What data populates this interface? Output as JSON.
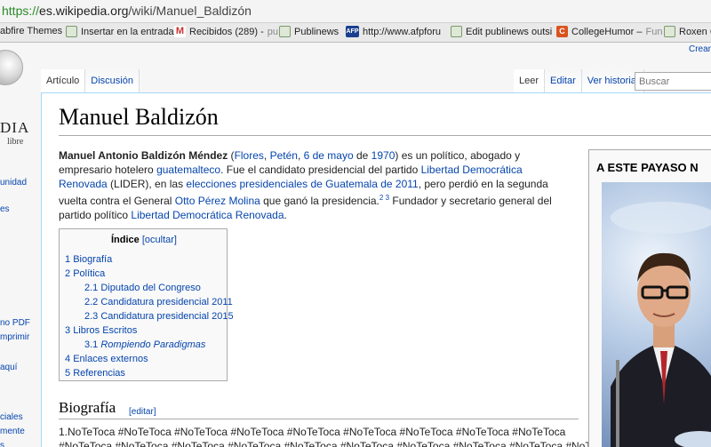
{
  "browser": {
    "url_scheme": "https://",
    "url_host": "es.wikipedia.org",
    "url_path": "/wiki/Manuel_Baldizón",
    "bookmarks": [
      {
        "label": "abfire Themes",
        "icon": "none",
        "ghost": ""
      },
      {
        "label": "Insertar en la entrada",
        "icon": "page-icon",
        "ghost": ""
      },
      {
        "label": "Recibidos (289) -",
        "icon": "gmail-icon",
        "ghost": "pu"
      },
      {
        "label": "Publinews",
        "icon": "page-icon",
        "ghost": ""
      },
      {
        "label": "http://www.afpforu",
        "icon": "afp-icon",
        "ghost": ""
      },
      {
        "label": "Edit publinews outsi",
        "icon": "page-icon",
        "ghost": ""
      },
      {
        "label": "CollegeHumor –",
        "icon": "ch-icon",
        "ghost": "Fun"
      },
      {
        "label": "Roxen C",
        "icon": "page-icon",
        "ghost": ""
      }
    ]
  },
  "wiki": {
    "logo_word": "DIA",
    "logo_sub": "libre",
    "crear": "Crear",
    "sidebar": [
      "unidad",
      "es",
      "no PDF",
      "mprimir",
      "aquí",
      "ciales",
      "mente",
      "s"
    ],
    "tabs_left": [
      "Artículo",
      "Discusión"
    ],
    "tabs_right": [
      "Leer",
      "Editar",
      "Ver historial"
    ],
    "search_placeholder": "Buscar",
    "title": "Manuel Baldizón",
    "lead": {
      "bold_name": "Manuel Antonio Baldizón Méndez",
      "open_paren": " (",
      "link_flores": "Flores",
      "comma1": ", ",
      "link_peten": "Petén",
      "comma2": ", ",
      "link_mayo": "6 de mayo",
      "de": " de ",
      "link_1970": "1970",
      "text1": ") es un político, abogado y empresario hotelero ",
      "link_guatemalteco": "guatemalteco",
      "text2": ". Fue el candidato presidencial del partido ",
      "link_lider": "Libertad Democrática Renovada",
      "text3": " (LIDER), en las ",
      "link_elecciones": "elecciones presidenciales de Guatemala de 2011",
      "text4": ", pero perdió en la segunda vuelta contra el General ",
      "link_otto": "Otto Pérez Molina",
      "text5": " que ganó la presidencia.",
      "sup": "2 3",
      "text6": " Fundador y secretario general del partido político ",
      "link_lider2": "Libertad Democrática Renovada",
      "text7": "."
    },
    "toc": {
      "title": "Índice",
      "toggle": "[ocultar]",
      "items": [
        {
          "num": "1",
          "text": "Biografía"
        },
        {
          "num": "2",
          "text": "Política"
        },
        {
          "num": "2.1",
          "text": "Diputado del Congreso"
        },
        {
          "num": "2.2",
          "text": "Candidatura presidencial 2011"
        },
        {
          "num": "2.3",
          "text": "Candidatura presidencial 2015"
        },
        {
          "num": "3",
          "text": "Libros Escritos"
        },
        {
          "num": "3.1",
          "text": "Rompiendo Paradigmas"
        },
        {
          "num": "4",
          "text": "Enlaces externos"
        },
        {
          "num": "5",
          "text": "Referencias"
        }
      ]
    },
    "section": {
      "title": "Biografía",
      "edit": "[editar]",
      "line1": "1.NoTeToca #NoTeToca #NoTeToca #NoTeToca #NoTeToca #NoTeToca #NoTeToca #NoTeToca #NoTeToca",
      "line2": "#NoTeToca #NoTeToca #NoTeToca #NoTeToca #NoTeToca #NoTeToca #NoTeToca #NoTeToca #NoTeToca #NoTeToca"
    },
    "infobox_caption": "A ESTE PAYASO N"
  }
}
